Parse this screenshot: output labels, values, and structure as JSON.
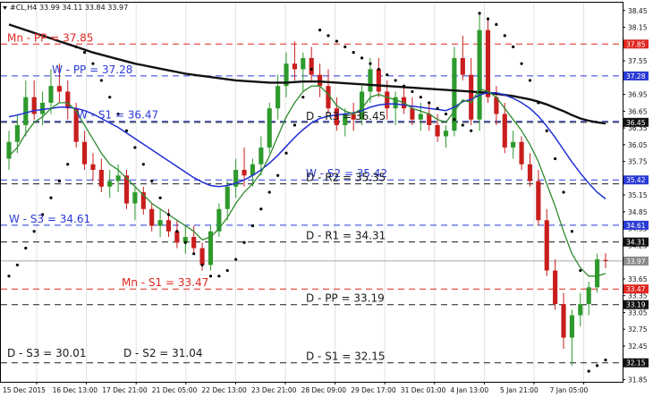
{
  "header": {
    "text": "#CL,H4  33.99 34.11 33.84 33.97"
  },
  "colors": {
    "bg": "#ffffff",
    "frame": "#000000",
    "grid": "#e0e0e0",
    "up": "#2e9a2e",
    "down": "#c81e1e",
    "ma_fast": "#2e8b2e",
    "ma_mid": "#1f2fd6",
    "ma_slow": "#111111",
    "sar": "#000000",
    "pivot_d": "#1a1a1a",
    "pivot_w": "#2a3ad6",
    "pivot_mn": "#e0261e"
  },
  "chart_data": {
    "type": "candlestick",
    "symbol": "#CL,H4",
    "ylim": [
      31.81,
      38.59
    ],
    "y_ticks": [
      "38.45",
      "38.15",
      "37.85",
      "37.55",
      "37.25",
      "36.95",
      "36.65",
      "36.35",
      "36.05",
      "35.75",
      "35.45",
      "35.15",
      "34.85",
      "34.55",
      "34.25",
      "33.95",
      "33.65",
      "33.35",
      "33.05",
      "32.75",
      "32.45",
      "32.15",
      "31.85"
    ],
    "x_labels": [
      "15 Dec 2015",
      "16 Dec 13:00",
      "17 Dec 21:00",
      "21 Dec 05:00",
      "22 Dec 13:00",
      "23 Dec 21:00",
      "28 Dec 09:00",
      "29 Dec 17:00",
      "31 Dec 01:00",
      "4 Jan 13:00",
      "5 Jan 21:00",
      "7 Jan 05:00"
    ],
    "levels": [
      {
        "label": "Mn - PP = 37.85",
        "value": 37.85,
        "group": "mn",
        "label_pos": "left"
      },
      {
        "label": "W - PP = 37.28",
        "value": 37.28,
        "group": "w",
        "label_pos": "left"
      },
      {
        "label": "W - S1 = 36.47",
        "value": 36.47,
        "group": "w",
        "label_pos": "left"
      },
      {
        "label": "D - R3 = 36.45",
        "value": 36.45,
        "group": "d",
        "label_pos": "mid"
      },
      {
        "label": "W - S2 = 35.42",
        "value": 35.42,
        "group": "w",
        "label_pos": "mid"
      },
      {
        "label": "D - R2 = 35.35",
        "value": 35.35,
        "group": "d",
        "label_pos": "mid"
      },
      {
        "label": "W - S3 = 34.61",
        "value": 34.61,
        "group": "w",
        "label_pos": "left"
      },
      {
        "label": "D - R1 = 34.31",
        "value": 34.31,
        "group": "d",
        "label_pos": "mid"
      },
      {
        "label": "Mn - S1 = 33.47",
        "value": 33.47,
        "group": "mn",
        "label_pos": "left"
      },
      {
        "label": "D - PP = 33.19",
        "value": 33.19,
        "group": "d",
        "label_pos": "mid"
      },
      {
        "label": "D - S1 = 32.15",
        "value": 32.15,
        "group": "d",
        "label_pos": "mid"
      }
    ],
    "price_badges": [
      {
        "text": "37.85",
        "value": 37.85,
        "color": "#e0261e"
      },
      {
        "text": "37.28",
        "value": 37.28,
        "color": "#2a3ad6"
      },
      {
        "text": "36.45",
        "value": 36.45,
        "color": "#111111"
      },
      {
        "text": "35.42",
        "value": 35.42,
        "color": "#2a3ad6"
      },
      {
        "text": "34.61",
        "value": 34.61,
        "color": "#2a3ad6"
      },
      {
        "text": "34.31",
        "value": 34.31,
        "color": "#111111"
      },
      {
        "text": "33.97",
        "value": 33.97,
        "color": "#8a8a8a"
      },
      {
        "text": "33.47",
        "value": 33.47,
        "color": "#e0261e"
      },
      {
        "text": "33.19",
        "value": 33.19,
        "color": "#111111"
      },
      {
        "text": "32.15",
        "value": 32.15,
        "color": "#111111"
      }
    ],
    "last_price": 33.97,
    "annotations": [
      {
        "text": "D - S3 = 30.01"
      },
      {
        "text": "D - S2 = 31.04"
      }
    ],
    "candles": [
      [
        35.8,
        36.3,
        35.6,
        36.1
      ],
      [
        36.1,
        36.6,
        35.9,
        36.4
      ],
      [
        36.4,
        37.2,
        36.2,
        36.9
      ],
      [
        36.9,
        37.2,
        36.5,
        36.6
      ],
      [
        36.6,
        37.0,
        36.4,
        36.8
      ],
      [
        36.8,
        37.4,
        36.6,
        37.1
      ],
      [
        37.1,
        37.5,
        36.8,
        37.0
      ],
      [
        37.0,
        37.2,
        36.5,
        36.7
      ],
      [
        36.7,
        36.8,
        36.0,
        36.1
      ],
      [
        36.1,
        36.3,
        35.6,
        35.7
      ],
      [
        35.7,
        35.9,
        35.4,
        35.6
      ],
      [
        35.6,
        35.8,
        35.2,
        35.3
      ],
      [
        35.3,
        35.6,
        35.1,
        35.4
      ],
      [
        35.4,
        35.7,
        35.2,
        35.5
      ],
      [
        35.5,
        35.6,
        34.9,
        35.0
      ],
      [
        35.0,
        35.3,
        34.7,
        35.2
      ],
      [
        35.2,
        35.3,
        34.8,
        34.9
      ],
      [
        34.9,
        35.0,
        34.5,
        34.6
      ],
      [
        34.6,
        34.9,
        34.4,
        34.7
      ],
      [
        34.7,
        34.9,
        34.4,
        34.5
      ],
      [
        34.5,
        34.7,
        34.2,
        34.3
      ],
      [
        34.3,
        34.6,
        34.1,
        34.4
      ],
      [
        34.4,
        34.6,
        34.1,
        34.2
      ],
      [
        34.2,
        34.3,
        33.8,
        33.9
      ],
      [
        33.9,
        34.6,
        33.8,
        34.5
      ],
      [
        34.5,
        35.0,
        34.4,
        34.9
      ],
      [
        34.9,
        35.4,
        34.7,
        35.3
      ],
      [
        35.3,
        35.8,
        35.1,
        35.6
      ],
      [
        35.6,
        36.0,
        35.3,
        35.5
      ],
      [
        35.5,
        35.8,
        35.3,
        35.7
      ],
      [
        35.7,
        36.2,
        35.5,
        36.0
      ],
      [
        36.0,
        36.8,
        35.9,
        36.7
      ],
      [
        36.7,
        37.3,
        36.5,
        37.1
      ],
      [
        37.1,
        37.7,
        36.9,
        37.5
      ],
      [
        37.5,
        37.9,
        37.2,
        37.4
      ],
      [
        37.4,
        37.7,
        37.0,
        37.6
      ],
      [
        37.6,
        37.8,
        37.2,
        37.3
      ],
      [
        37.3,
        37.5,
        36.9,
        37.1
      ],
      [
        37.1,
        37.4,
        36.6,
        36.7
      ],
      [
        36.7,
        36.9,
        36.3,
        36.4
      ],
      [
        36.4,
        36.7,
        36.2,
        36.6
      ],
      [
        36.6,
        36.8,
        36.3,
        36.5
      ],
      [
        36.5,
        37.1,
        36.4,
        37.0
      ],
      [
        37.0,
        37.6,
        36.8,
        37.4
      ],
      [
        37.4,
        37.6,
        36.9,
        37.0
      ],
      [
        37.0,
        37.2,
        36.5,
        36.7
      ],
      [
        36.7,
        37.0,
        36.4,
        36.9
      ],
      [
        36.9,
        37.1,
        36.6,
        36.7
      ],
      [
        36.7,
        36.9,
        36.4,
        36.5
      ],
      [
        36.5,
        36.8,
        36.3,
        36.6
      ],
      [
        36.6,
        36.8,
        36.3,
        36.4
      ],
      [
        36.4,
        36.6,
        36.1,
        36.2
      ],
      [
        36.2,
        36.4,
        36.0,
        36.3
      ],
      [
        36.3,
        37.8,
        36.2,
        37.6
      ],
      [
        37.6,
        38.0,
        37.2,
        37.3
      ],
      [
        37.3,
        37.6,
        36.4,
        36.5
      ],
      [
        36.5,
        38.4,
        36.3,
        38.1
      ],
      [
        38.1,
        38.3,
        36.8,
        36.9
      ],
      [
        36.9,
        37.1,
        36.4,
        36.6
      ],
      [
        36.6,
        36.8,
        35.9,
        36.0
      ],
      [
        36.0,
        36.3,
        35.8,
        36.1
      ],
      [
        36.1,
        36.2,
        35.6,
        35.7
      ],
      [
        35.7,
        35.9,
        35.3,
        35.4
      ],
      [
        35.4,
        35.6,
        34.6,
        34.7
      ],
      [
        34.7,
        34.9,
        33.7,
        33.8
      ],
      [
        33.8,
        34.0,
        33.1,
        33.2
      ],
      [
        33.2,
        33.4,
        32.4,
        32.6
      ],
      [
        32.6,
        33.1,
        32.1,
        33.0
      ],
      [
        33.0,
        33.4,
        32.8,
        33.2
      ],
      [
        33.2,
        33.6,
        33.0,
        33.5
      ],
      [
        33.5,
        34.1,
        33.4,
        34.0
      ],
      [
        33.99,
        34.11,
        33.84,
        33.97
      ]
    ],
    "ma_fast": [
      35.85,
      36.0,
      36.25,
      36.45,
      36.55,
      36.7,
      36.8,
      36.8,
      36.65,
      36.4,
      36.15,
      35.9,
      35.7,
      35.6,
      35.45,
      35.3,
      35.15,
      35.0,
      34.9,
      34.8,
      34.7,
      34.6,
      34.5,
      34.35,
      34.4,
      34.55,
      34.75,
      35.0,
      35.2,
      35.35,
      35.55,
      35.85,
      36.2,
      36.55,
      36.8,
      37.0,
      37.1,
      37.1,
      36.95,
      36.75,
      36.65,
      36.6,
      36.7,
      36.9,
      36.95,
      36.9,
      36.85,
      36.8,
      36.7,
      36.65,
      36.6,
      36.5,
      36.45,
      36.65,
      36.85,
      36.8,
      37.05,
      37.0,
      36.9,
      36.7,
      36.5,
      36.3,
      36.05,
      35.75,
      35.35,
      34.95,
      34.5,
      34.1,
      33.85,
      33.7,
      33.7,
      33.75
    ],
    "ma_mid": [
      36.55,
      36.58,
      36.62,
      36.66,
      36.68,
      36.7,
      36.72,
      36.72,
      36.7,
      36.66,
      36.6,
      36.52,
      36.44,
      36.36,
      36.26,
      36.16,
      36.06,
      35.96,
      35.86,
      35.76,
      35.66,
      35.56,
      35.46,
      35.38,
      35.32,
      35.3,
      35.32,
      35.36,
      35.42,
      35.5,
      35.6,
      35.72,
      35.86,
      36.02,
      36.18,
      36.32,
      36.44,
      36.52,
      36.56,
      36.58,
      36.6,
      36.62,
      36.66,
      36.72,
      36.76,
      36.78,
      36.78,
      36.76,
      36.74,
      36.72,
      36.7,
      36.68,
      36.66,
      36.72,
      36.82,
      36.86,
      36.94,
      36.98,
      36.98,
      36.94,
      36.88,
      36.8,
      36.7,
      36.56,
      36.38,
      36.18,
      35.96,
      35.74,
      35.54,
      35.36,
      35.2,
      35.08
    ],
    "ma_slow": [
      38.2,
      38.15,
      38.1,
      38.05,
      38.0,
      37.95,
      37.9,
      37.85,
      37.8,
      37.75,
      37.7,
      37.66,
      37.62,
      37.58,
      37.54,
      37.5,
      37.47,
      37.44,
      37.41,
      37.38,
      37.35,
      37.32,
      37.3,
      37.28,
      37.26,
      37.24,
      37.22,
      37.2,
      37.19,
      37.18,
      37.17,
      37.16,
      37.16,
      37.16,
      37.17,
      37.18,
      37.18,
      37.18,
      37.17,
      37.16,
      37.15,
      37.14,
      37.13,
      37.12,
      37.11,
      37.1,
      37.09,
      37.08,
      37.07,
      37.06,
      37.05,
      37.04,
      37.03,
      37.02,
      37.01,
      37.0,
      36.99,
      36.98,
      36.96,
      36.94,
      36.92,
      36.89,
      36.86,
      36.82,
      36.77,
      36.71,
      36.65,
      36.58,
      36.52,
      36.48,
      36.45,
      36.43
    ],
    "sar": [
      33.7,
      33.9,
      34.2,
      34.5,
      34.8,
      35.1,
      35.4,
      35.7,
      37.8,
      37.7,
      37.5,
      37.2,
      36.9,
      36.6,
      36.3,
      36.0,
      35.7,
      35.4,
      35.1,
      34.8,
      34.5,
      34.3,
      34.1,
      33.9,
      33.7,
      33.7,
      33.8,
      34.0,
      34.3,
      34.6,
      34.9,
      35.2,
      35.5,
      35.9,
      36.4,
      36.9,
      37.4,
      38.1,
      38.0,
      37.9,
      37.8,
      37.7,
      37.6,
      37.5,
      37.4,
      37.3,
      37.2,
      37.1,
      37.0,
      36.9,
      36.8,
      36.7,
      36.6,
      36.5,
      36.4,
      36.3,
      38.4,
      38.3,
      38.2,
      38.0,
      37.8,
      37.5,
      37.2,
      36.8,
      36.3,
      35.8,
      35.2,
      34.5,
      33.8,
      32.0,
      32.1,
      32.2
    ]
  }
}
